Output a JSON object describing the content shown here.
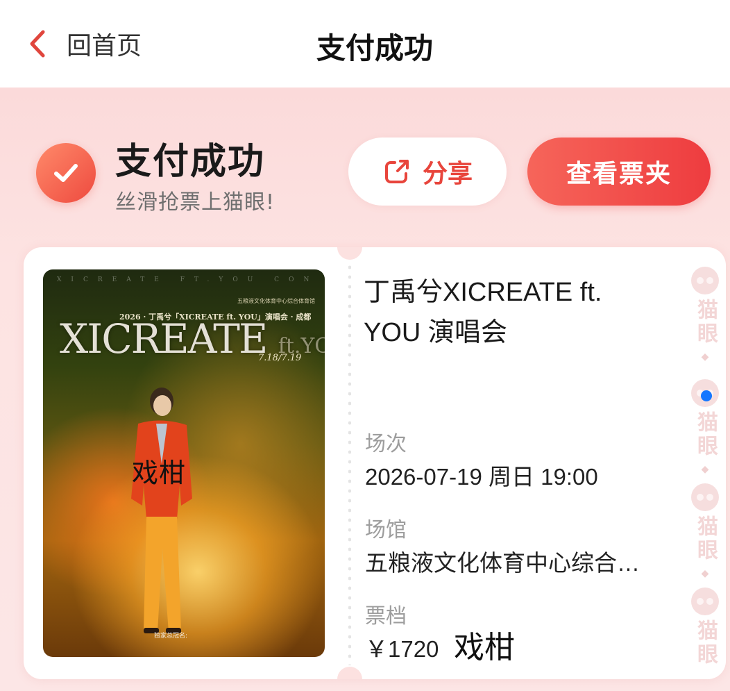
{
  "nav": {
    "back_label": "回首页",
    "title": "支付成功"
  },
  "status": {
    "title": "支付成功",
    "subtitle": "丝滑抢票上猫眼!",
    "share_label": "分享",
    "wallet_label": "查看票夹"
  },
  "poster": {
    "top_line": "XICREATE FT.YOU CONCERT",
    "header_line": "2026 · 丁禹兮「XICREATE ft. YOU」演唱会 · 成都",
    "venue_mini": "五粮液文化体育中心综合体育馆",
    "title_main": "XICREATE",
    "title_ft": "ft.YOU",
    "dates": "7.18/7.19",
    "watermark": "戏柑",
    "footer_sponsor": "独家总冠名:"
  },
  "ticket": {
    "show_title": "丁禹兮XICREATE ft. YOU 演唱会",
    "session_label": "场次",
    "session_value": "2026-07-19 周日 19:00",
    "venue_label": "场馆",
    "venue_value": "五粮液文化体育中心综合…",
    "tier_label": "票档",
    "tier_value": "￥1720",
    "tier_watermark": "戏柑"
  },
  "brand": {
    "side_text": "猫眼"
  },
  "colors": {
    "accent_red": "#ee3c3f",
    "success_orange": "#f26a52",
    "page_pink": "#fce1e0",
    "label_gray": "#9d9d9d"
  }
}
